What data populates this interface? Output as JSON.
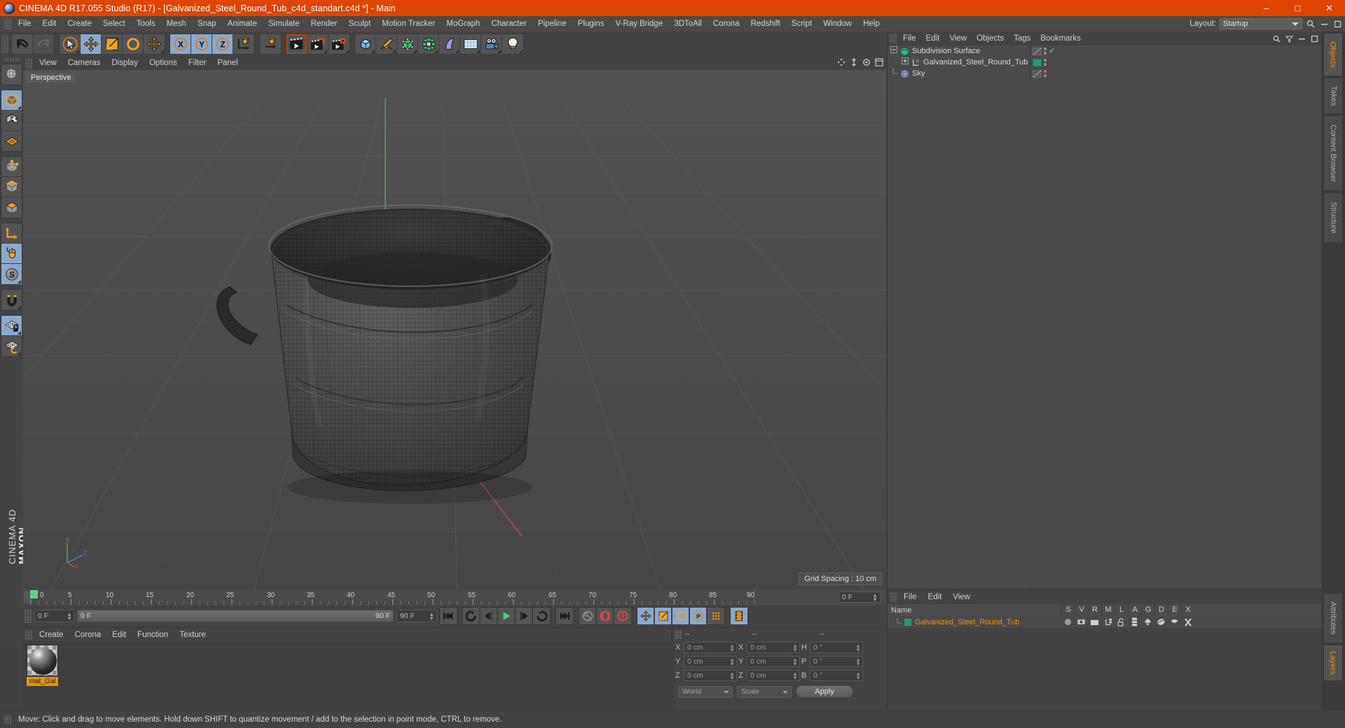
{
  "titlebar": {
    "app_icon": "cinema4d-logo-icon",
    "title": "CINEMA 4D R17.055 Studio (R17) - [Galvanized_Steel_Round_Tub_c4d_standart.c4d *] - Main",
    "minimize": "–",
    "maximize": "□",
    "close": "✕",
    "bg": "#e04403"
  },
  "menubar": {
    "items": [
      "File",
      "Edit",
      "Create",
      "Select",
      "Tools",
      "Mesh",
      "Snap",
      "Animate",
      "Simulate",
      "Render",
      "Sculpt",
      "Motion Tracker",
      "MoGraph",
      "Character",
      "Pipeline",
      "Plugins",
      "V-Ray Bridge",
      "3DToAll",
      "Corona",
      "Redshift",
      "Script",
      "Window",
      "Help"
    ],
    "layout_label": "Layout:",
    "layout_value": "Startup",
    "search_icon": "search-icon",
    "minimize_icon": "minimize-icon",
    "restore_icon": "restore-icon"
  },
  "toolbar": {
    "groups": [
      {
        "name": "undo-redo",
        "buttons": [
          {
            "name": "undo-button",
            "icon": "undo-arrow-icon",
            "state": "normal"
          },
          {
            "name": "redo-button",
            "icon": "redo-arrow-icon",
            "state": "disabled"
          }
        ]
      },
      {
        "name": "transform-tools",
        "buttons": [
          {
            "name": "live-selection-tool",
            "icon": "cursor-circle-icon",
            "state": "normal"
          },
          {
            "name": "move-tool",
            "icon": "move-arrows-icon",
            "state": "selected"
          },
          {
            "name": "scale-tool",
            "icon": "scale-box-icon",
            "state": "normal"
          },
          {
            "name": "rotate-tool",
            "icon": "rotate-circle-icon",
            "state": "normal"
          },
          {
            "name": "move-secondary-tool",
            "icon": "move-arrows-icon",
            "state": "normal"
          }
        ]
      },
      {
        "name": "axis-locks",
        "buttons": [
          {
            "name": "lock-x-axis",
            "icon": "x-axis-icon",
            "state": "selected"
          },
          {
            "name": "lock-y-axis",
            "icon": "y-axis-icon",
            "state": "selected"
          },
          {
            "name": "lock-z-axis",
            "icon": "z-axis-icon",
            "state": "selected"
          },
          {
            "name": "world-object-coordinate",
            "icon": "world-axis-icon",
            "state": "normal"
          }
        ]
      },
      {
        "name": "render-group",
        "buttons": [
          {
            "name": "render-view-button",
            "icon": "clapper-render-icon",
            "state": "highlight"
          },
          {
            "name": "render-to-picture-viewer",
            "icon": "clapper-picture-icon",
            "state": "normal"
          },
          {
            "name": "render-settings",
            "icon": "clapper-gear-icon",
            "state": "normal"
          }
        ]
      },
      {
        "name": "create-group",
        "buttons": [
          {
            "name": "add-cube-button",
            "icon": "cube-icon",
            "state": "normal"
          },
          {
            "name": "add-spline-button",
            "icon": "pen-spline-icon",
            "state": "normal"
          },
          {
            "name": "add-nurbs-button",
            "icon": "green-nurbs-icon",
            "state": "normal"
          },
          {
            "name": "add-mograph-button",
            "icon": "green-cluster-icon",
            "state": "normal"
          },
          {
            "name": "add-deformer-button",
            "icon": "bend-deformer-icon",
            "state": "normal"
          },
          {
            "name": "add-environment-button",
            "icon": "floor-grid-icon",
            "state": "normal"
          },
          {
            "name": "add-camera-button",
            "icon": "camera-icon",
            "state": "normal"
          },
          {
            "name": "add-light-button",
            "icon": "lightbulb-icon",
            "state": "normal"
          }
        ]
      }
    ]
  },
  "left_toolbar": {
    "buttons": [
      {
        "name": "undo-view-button",
        "icon": "globe-sphere-icon",
        "state": "normal"
      },
      {
        "name": "model-mode-button",
        "icon": "model-cube-icon",
        "state": "selected"
      },
      {
        "name": "texture-mode-button",
        "icon": "texture-cube-icon",
        "state": "normal"
      },
      {
        "name": "workplane-mode-button",
        "icon": "workplane-grid-icon",
        "state": "normal"
      },
      {
        "name": "points-mode-button",
        "icon": "points-cube-icon",
        "state": "normal"
      },
      {
        "name": "edges-mode-button",
        "icon": "edges-cube-icon",
        "state": "normal"
      },
      {
        "name": "polygons-mode-button",
        "icon": "polygons-cube-icon",
        "state": "normal"
      },
      {
        "name": "enable-axis-button",
        "icon": "axis-arrow-icon",
        "state": "normal"
      },
      {
        "name": "viewport-solo-button",
        "icon": "mouse-icon",
        "state": "selected"
      },
      {
        "name": "soft-selection-button",
        "icon": "s-sphere-icon",
        "state": "selected"
      },
      {
        "name": "enable-snap-button",
        "icon": "magnet-icon",
        "state": "normal"
      },
      {
        "name": "lock-workplane-button",
        "icon": "grid-lock-icon",
        "state": "selected"
      },
      {
        "name": "planar-workplane-button",
        "icon": "grid-rotate-icon",
        "state": "normal"
      }
    ],
    "brand_line1": "MAXON",
    "brand_line2": "CINEMA 4D"
  },
  "viewport": {
    "menu": [
      "View",
      "Cameras",
      "Display",
      "Options",
      "Filter",
      "Panel"
    ],
    "corner_icons": [
      "pan-icon",
      "zoom-icon",
      "rotate-icon",
      "maximize-viewport-icon"
    ],
    "label": "Perspective",
    "grid_spacing": "Grid Spacing : 10 cm",
    "axis_labels": {
      "y": "Y",
      "z": "Z",
      "x": "X"
    },
    "object_name": "Galvanized Steel Round Tub"
  },
  "timeline": {
    "ticks": [
      "0",
      "5",
      "10",
      "15",
      "20",
      "25",
      "30",
      "35",
      "40",
      "45",
      "50",
      "55",
      "60",
      "65",
      "70",
      "75",
      "80",
      "85",
      "90"
    ],
    "current_frame_field": "0 F",
    "start_frame": "0 F",
    "end_frame": "90 F",
    "range_end_field": "90 F",
    "frame_left_field": "0 F",
    "playhead_frame": 0
  },
  "animbar": {
    "buttons": [
      {
        "name": "go-to-start-button",
        "icon": "skip-start-icon",
        "state": "normal"
      },
      {
        "name": "play-backwards-button",
        "icon": "rewind-icon",
        "state": "normal"
      },
      {
        "name": "step-back-button",
        "icon": "step-back-icon",
        "state": "normal"
      },
      {
        "name": "play-forward-button",
        "icon": "play-icon",
        "state": "normal"
      },
      {
        "name": "step-forward-button",
        "icon": "step-forward-icon",
        "state": "normal"
      },
      {
        "name": "play-loop-button",
        "icon": "loop-icon",
        "state": "normal"
      },
      {
        "name": "go-to-end-button",
        "icon": "skip-end-icon",
        "state": "normal"
      },
      {
        "name": "record-active-objects-button",
        "icon": "key-icon",
        "state": "disabled"
      },
      {
        "name": "autokeying-button",
        "icon": "autokey-icon",
        "state": "normal"
      },
      {
        "name": "keyframe-selection-button",
        "icon": "question-key-icon",
        "state": "normal"
      },
      {
        "name": "position-key-button",
        "icon": "position-move-icon",
        "state": "selected"
      },
      {
        "name": "scale-key-button",
        "icon": "scale-key-icon",
        "state": "selected"
      },
      {
        "name": "rotation-key-button",
        "icon": "rotation-key-icon",
        "state": "selected"
      },
      {
        "name": "parameter-key-button",
        "icon": "p-param-icon",
        "state": "selected"
      },
      {
        "name": "point-level-animation-button",
        "icon": "pla-dots-icon",
        "state": "normal"
      },
      {
        "name": "timeline-toggle-button",
        "icon": "film-strip-icon",
        "state": "selected"
      }
    ]
  },
  "material_manager": {
    "menu": [
      "Create",
      "Corona",
      "Edit",
      "Function",
      "Texture"
    ],
    "materials": [
      {
        "name": "mat_Gal",
        "preview": "metal-sphere-preview"
      }
    ]
  },
  "coordinates": {
    "header_dashes": [
      "--",
      "--",
      "--"
    ],
    "rows": [
      {
        "pos_label": "X",
        "pos_value": "0 cm",
        "size_label": "X",
        "size_value": "0 cm",
        "rot_label": "H",
        "rot_value": "0 °"
      },
      {
        "pos_label": "Y",
        "pos_value": "0 cm",
        "size_label": "Y",
        "size_value": "0 cm",
        "rot_label": "P",
        "rot_value": "0 °"
      },
      {
        "pos_label": "Z",
        "pos_value": "0 cm",
        "size_label": "Z",
        "size_value": "0 cm",
        "rot_label": "B",
        "rot_value": "0 °"
      }
    ],
    "coord_system": "World",
    "mode": "Scale",
    "apply_label": "Apply"
  },
  "object_manager": {
    "menu": [
      "File",
      "Edit",
      "View",
      "Objects",
      "Tags",
      "Bookmarks"
    ],
    "tools": [
      "search-icon",
      "filter-icon",
      "minimize-icon",
      "restore-icon"
    ],
    "items": [
      {
        "name": "Subdivision Surface",
        "icon": "subdivision-surface-icon",
        "depth": 0,
        "expanded": true,
        "tag_swatch": "hatched",
        "dots": 2,
        "check": true,
        "red": false
      },
      {
        "name": "Galvanized_Steel_Round_Tub",
        "icon": "null-object-icon",
        "depth": 1,
        "expanded": false,
        "tag_swatch": "#1d9b7e",
        "dots": 2,
        "check": false,
        "red": false
      },
      {
        "name": "Sky",
        "icon": "sky-icon",
        "depth": 0,
        "expanded": false,
        "tag_swatch": "hatched",
        "dots": 2,
        "check": false,
        "red": true
      }
    ]
  },
  "bottom_right": {
    "menu": [
      "File",
      "Edit",
      "View"
    ],
    "columns": [
      "S",
      "V",
      "R",
      "M",
      "L",
      "A",
      "G",
      "D",
      "E",
      "X"
    ],
    "name_header": "Name",
    "rows": [
      {
        "name": "Galvanized_Steel_Round_Tub",
        "swatch": "#1d9b7e",
        "icons": [
          "grey-dot-icon",
          "visibility-icon",
          "render-icon",
          "hierarchy-icon",
          "unlock-icon",
          "animation-icon",
          "generator-icon",
          "deformer-icon",
          "expression-icon",
          "xref-icon"
        ]
      }
    ]
  },
  "right_tabs": {
    "top": [
      {
        "label": "Objects",
        "active": true
      },
      {
        "label": "Takes",
        "active": false
      },
      {
        "label": "Content Browser",
        "active": false
      },
      {
        "label": "Structure",
        "active": false
      }
    ],
    "bottom": [
      {
        "label": "Attributes",
        "active": false
      },
      {
        "label": "Layers",
        "active": true
      }
    ]
  },
  "statusbar": {
    "message": "Move: Click and drag to move elements. Hold down SHIFT to quantize movement / add to the selection in point mode, CTRL to remove."
  },
  "colors": {
    "accent_orange": "#e04403",
    "selected_blue": "#8aa8cd",
    "highlight_orange": "#e8920d",
    "panel_bg": "#434343",
    "viewport_bg": "#4b4b4b",
    "teal_swatch": "#1d9b7e"
  }
}
